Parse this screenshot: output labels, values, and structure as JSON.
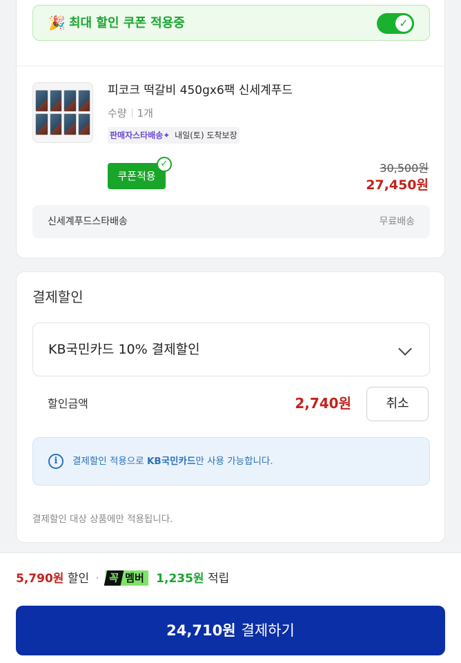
{
  "order": {
    "coupon_banner": {
      "icon": "party-popper-icon",
      "label": "최대 할인 쿠폰 적용중",
      "toggle_on": true
    },
    "product": {
      "name": "피코크 떡갈비 450gx6팩 신세계푸드",
      "qty_label": "수량",
      "qty_value": "1개",
      "delivery_badge": "판매자스타배송",
      "delivery_star": "✦",
      "arrival": "내일(토) 도착보장",
      "coupon_button": "쿠폰적용",
      "original_price": "30,500원",
      "sale_price": "27,450원"
    },
    "shipping": {
      "name": "신세계푸드스타배송",
      "fee": "무료배송"
    }
  },
  "payment_discount": {
    "title": "결제할인",
    "selected_card": "KB국민카드 10% 결제할인",
    "discount_label": "할인금액",
    "discount_amount": "2,740원",
    "cancel_label": "취소",
    "info_prefix": "결제할인 적용으로 ",
    "info_card": "KB국민카드",
    "info_suffix": "만 사용 가능합니다.",
    "note": "결제할인 대상 상품에만 적용됩니다."
  },
  "footer": {
    "discount_total": "5,790원",
    "discount_word": "할인",
    "dot": "·",
    "member_badge_left": "꼭",
    "member_badge_right": "멤버",
    "points": "1,235원",
    "points_word": "적립",
    "pay_amount": "24,710원",
    "pay_label": "결제하기"
  },
  "colors": {
    "accent_green": "#1ab12f",
    "price_red": "#c3221d",
    "pay_blue": "#0b2fa6",
    "info_blue": "#2b72b8"
  }
}
